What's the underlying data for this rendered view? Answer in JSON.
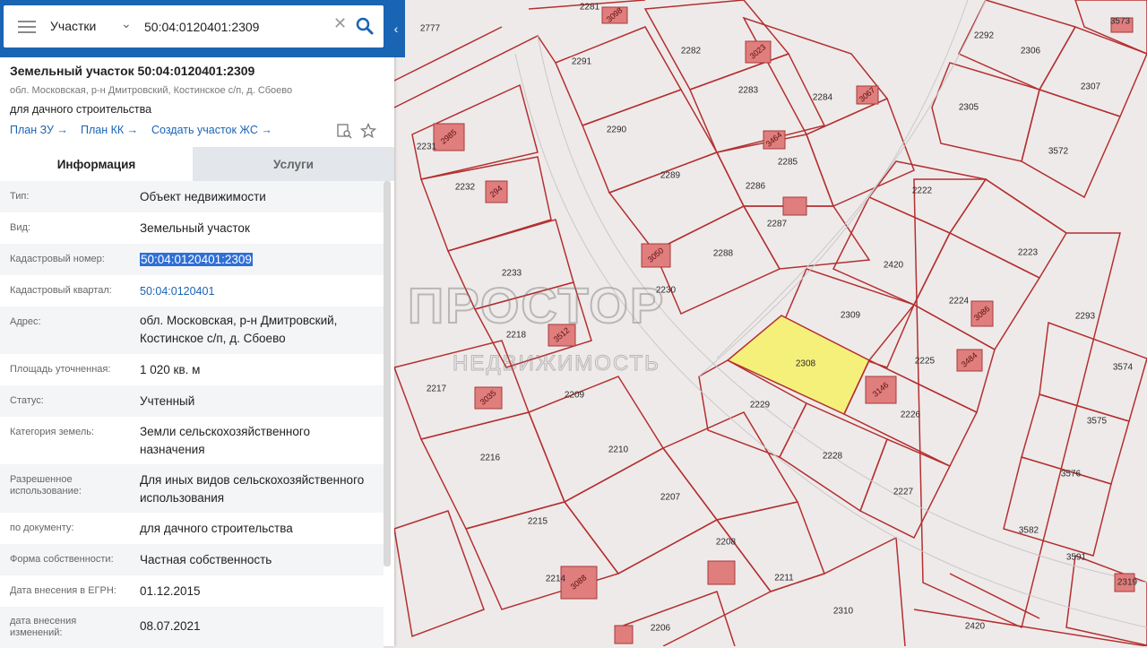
{
  "search": {
    "layer": "Участки",
    "query": "50:04:0120401:2309"
  },
  "parcel": {
    "title": "Земельный участок 50:04:0120401:2309",
    "address_short": "обл. Московская, р-н Дмитровский, Костинское с/п, д. Сбоево",
    "purpose": "для дачного строительства",
    "links": [
      "План ЗУ →",
      "План КК →",
      "Создать участок ЖС →"
    ]
  },
  "tabs": [
    "Информация",
    "Услуги"
  ],
  "info": [
    {
      "label": "Тип:",
      "value": "Объект недвижимости"
    },
    {
      "label": "Вид:",
      "value": "Земельный участок"
    },
    {
      "label": "Кадастровый номер:",
      "value": "50:04:0120401:2309"
    },
    {
      "label": "Кадастровый квартал:",
      "value": "50:04:0120401"
    },
    {
      "label": "Адрес:",
      "value": "обл. Московская, р-н Дмитровский, Костинское с/п, д. Сбоево"
    },
    {
      "label": "Площадь уточненная:",
      "value": "1 020 кв. м"
    },
    {
      "label": "Статус:",
      "value": "Учтенный"
    },
    {
      "label": "Категория земель:",
      "value": "Земли сельскохозяйственного назначения"
    },
    {
      "label": "Разрешенное использование:",
      "value": "Для иных видов сельскохозяйственного использования"
    },
    {
      "label": "по документу:",
      "value": "для дачного строительства"
    },
    {
      "label": "Форма собственности:",
      "value": "Частная собственность"
    },
    {
      "label": "Дата внесения в ЕГРН:",
      "value": "01.12.2015"
    },
    {
      "label": "дата внесения изменений:",
      "value": "08.07.2021"
    }
  ],
  "map": {
    "watermark_title": "ПРОСТОР",
    "watermark_sub": "НЕДВИЖИМОСТЬ",
    "highlight_color": "#f5f07a",
    "plot_border_color": "#b33030",
    "building_color": "#e07d7d",
    "plots": [
      "2777",
      "2281",
      "2291",
      "2282",
      "2283",
      "2284",
      "2290",
      "2289",
      "2285",
      "2286",
      "2287",
      "2288",
      "2230",
      "2231",
      "2232",
      "2233",
      "2218",
      "2217",
      "2216",
      "2215",
      "2214",
      "2206",
      "2209",
      "2210",
      "2207",
      "2208",
      "2211",
      "2310",
      "2309",
      "2308",
      "2229",
      "2228",
      "2227",
      "2226",
      "2225",
      "2224",
      "2223",
      "2222",
      "2420",
      "2293",
      "2292",
      "2306",
      "2307",
      "2305",
      "3572",
      "3573",
      "3574",
      "3575",
      "3576",
      "3582",
      "3591",
      "2319",
      "2420"
    ],
    "buildings": [
      "3098",
      "3023",
      "3067",
      "3464",
      "2985",
      "294",
      "3050",
      "3512",
      "3035",
      "3088",
      "3146",
      "3484",
      "3086"
    ]
  }
}
